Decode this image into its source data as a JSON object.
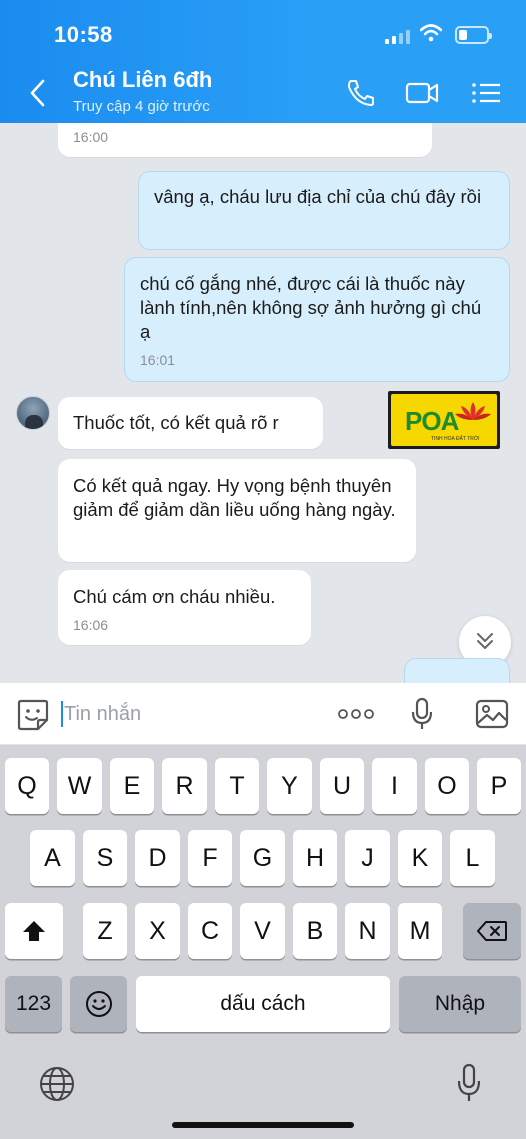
{
  "status": {
    "time": "10:58"
  },
  "header": {
    "title": "Chú Liên 6đh",
    "subtitle": "Truy cập 4 giờ trước"
  },
  "messages": [
    {
      "dir": "in",
      "text": "",
      "time": "16:00"
    },
    {
      "dir": "out",
      "text": "vâng ạ, cháu lưu địa chỉ của chú đây rồi",
      "time": ""
    },
    {
      "dir": "out",
      "text": "chú cố gắng nhé, được cái là thuốc này lành tính,nên không sợ ảnh hưởng gì chú ạ",
      "time": "16:01"
    },
    {
      "dir": "in",
      "text": "Thuốc tốt, có kết quả rõ r",
      "time": ""
    },
    {
      "dir": "in",
      "text": "Có kết quả ngay. Hy vọng bệnh thuyên giảm để giảm dần liều uống hàng ngày.",
      "time": ""
    },
    {
      "dir": "in",
      "text": "Chú cám ơn cháu nhiều.",
      "time": "16:06"
    }
  ],
  "logo": {
    "text": "POA",
    "sub": "TINH HOA ĐẤT TRỜI"
  },
  "input": {
    "placeholder": "Tin nhắn"
  },
  "keyboard": {
    "row1": [
      "Q",
      "W",
      "E",
      "R",
      "T",
      "Y",
      "U",
      "I",
      "O",
      "P"
    ],
    "row2": [
      "A",
      "S",
      "D",
      "F",
      "G",
      "H",
      "J",
      "K",
      "L"
    ],
    "row3": [
      "Z",
      "X",
      "C",
      "V",
      "B",
      "N",
      "M"
    ],
    "numbers_label": "123",
    "space_label": "dấu cách",
    "return_label": "Nhập"
  },
  "colors": {
    "header": "#1a8cf0",
    "outgoing": "#d7eefc",
    "incoming": "#ffffff"
  }
}
